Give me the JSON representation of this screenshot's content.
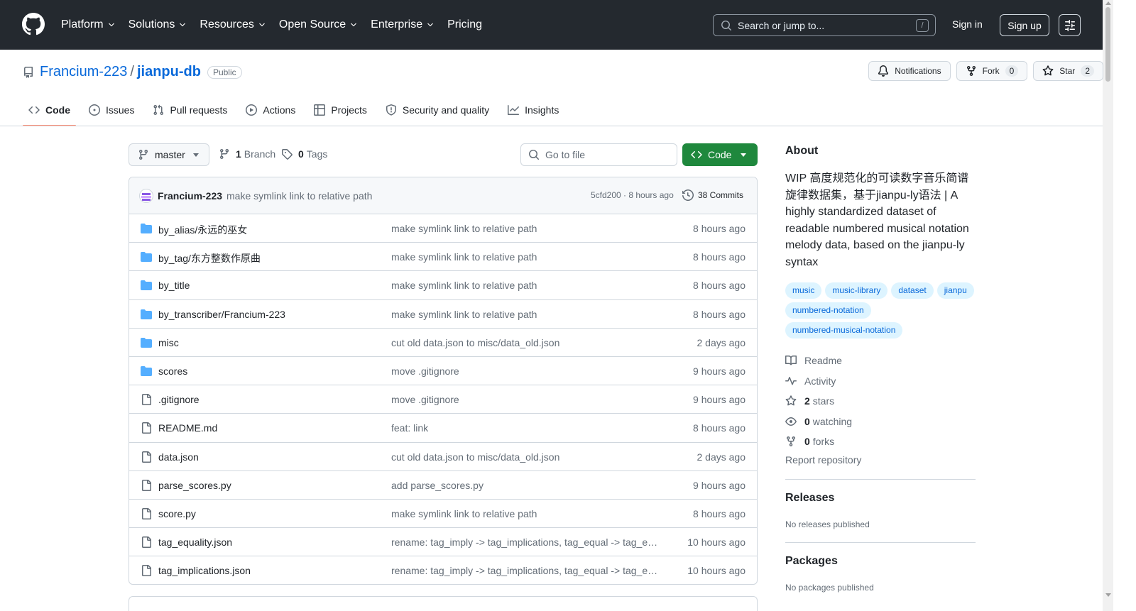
{
  "header": {
    "nav": [
      {
        "label": "Platform",
        "has_menu": true
      },
      {
        "label": "Solutions",
        "has_menu": true
      },
      {
        "label": "Resources",
        "has_menu": true
      },
      {
        "label": "Open Source",
        "has_menu": true
      },
      {
        "label": "Enterprise",
        "has_menu": true
      },
      {
        "label": "Pricing",
        "has_menu": false
      }
    ],
    "search_placeholder": "Search or jump to...",
    "search_shortcut": "/",
    "sign_in": "Sign in",
    "sign_up": "Sign up"
  },
  "repo": {
    "owner": "Francium-223",
    "separator": "/",
    "name": "jianpu-db",
    "visibility": "Public",
    "notifications_label": "Notifications",
    "fork_label": "Fork",
    "fork_count": "0",
    "star_label": "Star",
    "star_count": "2"
  },
  "tabs": [
    {
      "label": "Code",
      "icon": "code-icon",
      "active": true
    },
    {
      "label": "Issues",
      "icon": "issue-icon",
      "active": false
    },
    {
      "label": "Pull requests",
      "icon": "pull-request-icon",
      "active": false
    },
    {
      "label": "Actions",
      "icon": "play-icon",
      "active": false
    },
    {
      "label": "Projects",
      "icon": "table-icon",
      "active": false
    },
    {
      "label": "Security and quality",
      "icon": "shield-icon",
      "active": false
    },
    {
      "label": "Insights",
      "icon": "graph-icon",
      "active": false
    }
  ],
  "toolbar": {
    "branch": "master",
    "branch_count": "1",
    "branch_label": "Branch",
    "tag_count": "0",
    "tag_label": "Tags",
    "goto_placeholder": "Go to file",
    "code_label": "Code"
  },
  "latest_commit": {
    "author": "Francium-223",
    "message": "make symlink link to relative path",
    "sha_time": "5cfd200 · 8 hours ago",
    "commits": "38 Commits"
  },
  "files": [
    {
      "type": "dir",
      "name": "by_alias/永远的巫女",
      "message": "make symlink link to relative path",
      "age": "8 hours ago"
    },
    {
      "type": "dir",
      "name": "by_tag/东方整数作原曲",
      "message": "make symlink link to relative path",
      "age": "8 hours ago"
    },
    {
      "type": "dir",
      "name": "by_title",
      "message": "make symlink link to relative path",
      "age": "8 hours ago"
    },
    {
      "type": "dir",
      "name": "by_transcriber/Francium-223",
      "message": "make symlink link to relative path",
      "age": "8 hours ago"
    },
    {
      "type": "dir",
      "name": "misc",
      "message": "cut old data.json to misc/data_old.json",
      "age": "2 days ago"
    },
    {
      "type": "dir",
      "name": "scores",
      "message": "move .gitignore",
      "age": "9 hours ago"
    },
    {
      "type": "file",
      "name": ".gitignore",
      "message": "move .gitignore",
      "age": "9 hours ago"
    },
    {
      "type": "file",
      "name": "README.md",
      "message": "feat: link",
      "age": "8 hours ago"
    },
    {
      "type": "file",
      "name": "data.json",
      "message": "cut old data.json to misc/data_old.json",
      "age": "2 days ago"
    },
    {
      "type": "file",
      "name": "parse_scores.py",
      "message": "add parse_scores.py",
      "age": "9 hours ago"
    },
    {
      "type": "file",
      "name": "score.py",
      "message": "make symlink link to relative path",
      "age": "8 hours ago"
    },
    {
      "type": "file",
      "name": "tag_equality.json",
      "message": "rename: tag_imply -> tag_implications, tag_equal -> tag_eq…",
      "age": "10 hours ago"
    },
    {
      "type": "file",
      "name": "tag_implications.json",
      "message": "rename: tag_imply -> tag_implications, tag_equal -> tag_eq…",
      "age": "10 hours ago"
    }
  ],
  "about": {
    "heading": "About",
    "description": "WIP 高度规范化的可读数字音乐简谱旋律数据集，基于jianpu-ly语法 | A highly standardized dataset of readable numbered musical notation melody data, based on the jianpu-ly syntax",
    "topics": [
      "music",
      "music-library",
      "dataset",
      "jianpu",
      "numbered-notation",
      "numbered-musical-notation"
    ],
    "links": [
      {
        "icon": "book-icon",
        "count": "",
        "label": "Readme"
      },
      {
        "icon": "pulse-icon",
        "count": "",
        "label": "Activity"
      },
      {
        "icon": "star-icon",
        "count": "2",
        "label": "stars"
      },
      {
        "icon": "eye-icon",
        "count": "0",
        "label": "watching"
      },
      {
        "icon": "fork-icon",
        "count": "0",
        "label": "forks"
      }
    ],
    "report": "Report repository"
  },
  "releases": {
    "heading": "Releases",
    "note": "No releases published"
  },
  "packages": {
    "heading": "Packages",
    "note": "No packages published"
  },
  "colors": {
    "header_bg": "#24292f",
    "link": "#0969da",
    "primary_button": "#1f883d",
    "active_tab_underline": "#fd8c73",
    "folder": "#54aeff",
    "topic_bg": "#ddf4ff"
  }
}
